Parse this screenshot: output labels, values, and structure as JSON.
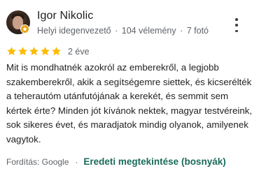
{
  "reviewer": {
    "name": "Igor Nikolic",
    "role": "Helyi idegenvezető",
    "separator": "·",
    "review_count": "104 vélemény",
    "photo_count": "7 fotó"
  },
  "rating": {
    "stars": 5,
    "max_stars": 5,
    "age": "2 éve",
    "star_color": "#fbbc04"
  },
  "review_text": "Mit is mondhatnék azokról az emberekről, a legjobb szakemberekről, akik a segítségemre siettek, és kicserélték a teherautóm utánfutójának a kerekét, és semmit sem kértek érte? Minden jót kívánok nektek, magyar testvéreink, sok sikeres évet, és maradjatok mindig olyanok, amilyenek vagytok.",
  "footer": {
    "translated_by": "Fordítás: Google",
    "separator": "·",
    "show_original": "Eredeti megtekintése (bosnyák)",
    "link_color": "#1a6b5c"
  },
  "icons": {
    "menu": "more-vert-icon",
    "badge": "local-guide-badge-icon",
    "star": "star-icon"
  }
}
